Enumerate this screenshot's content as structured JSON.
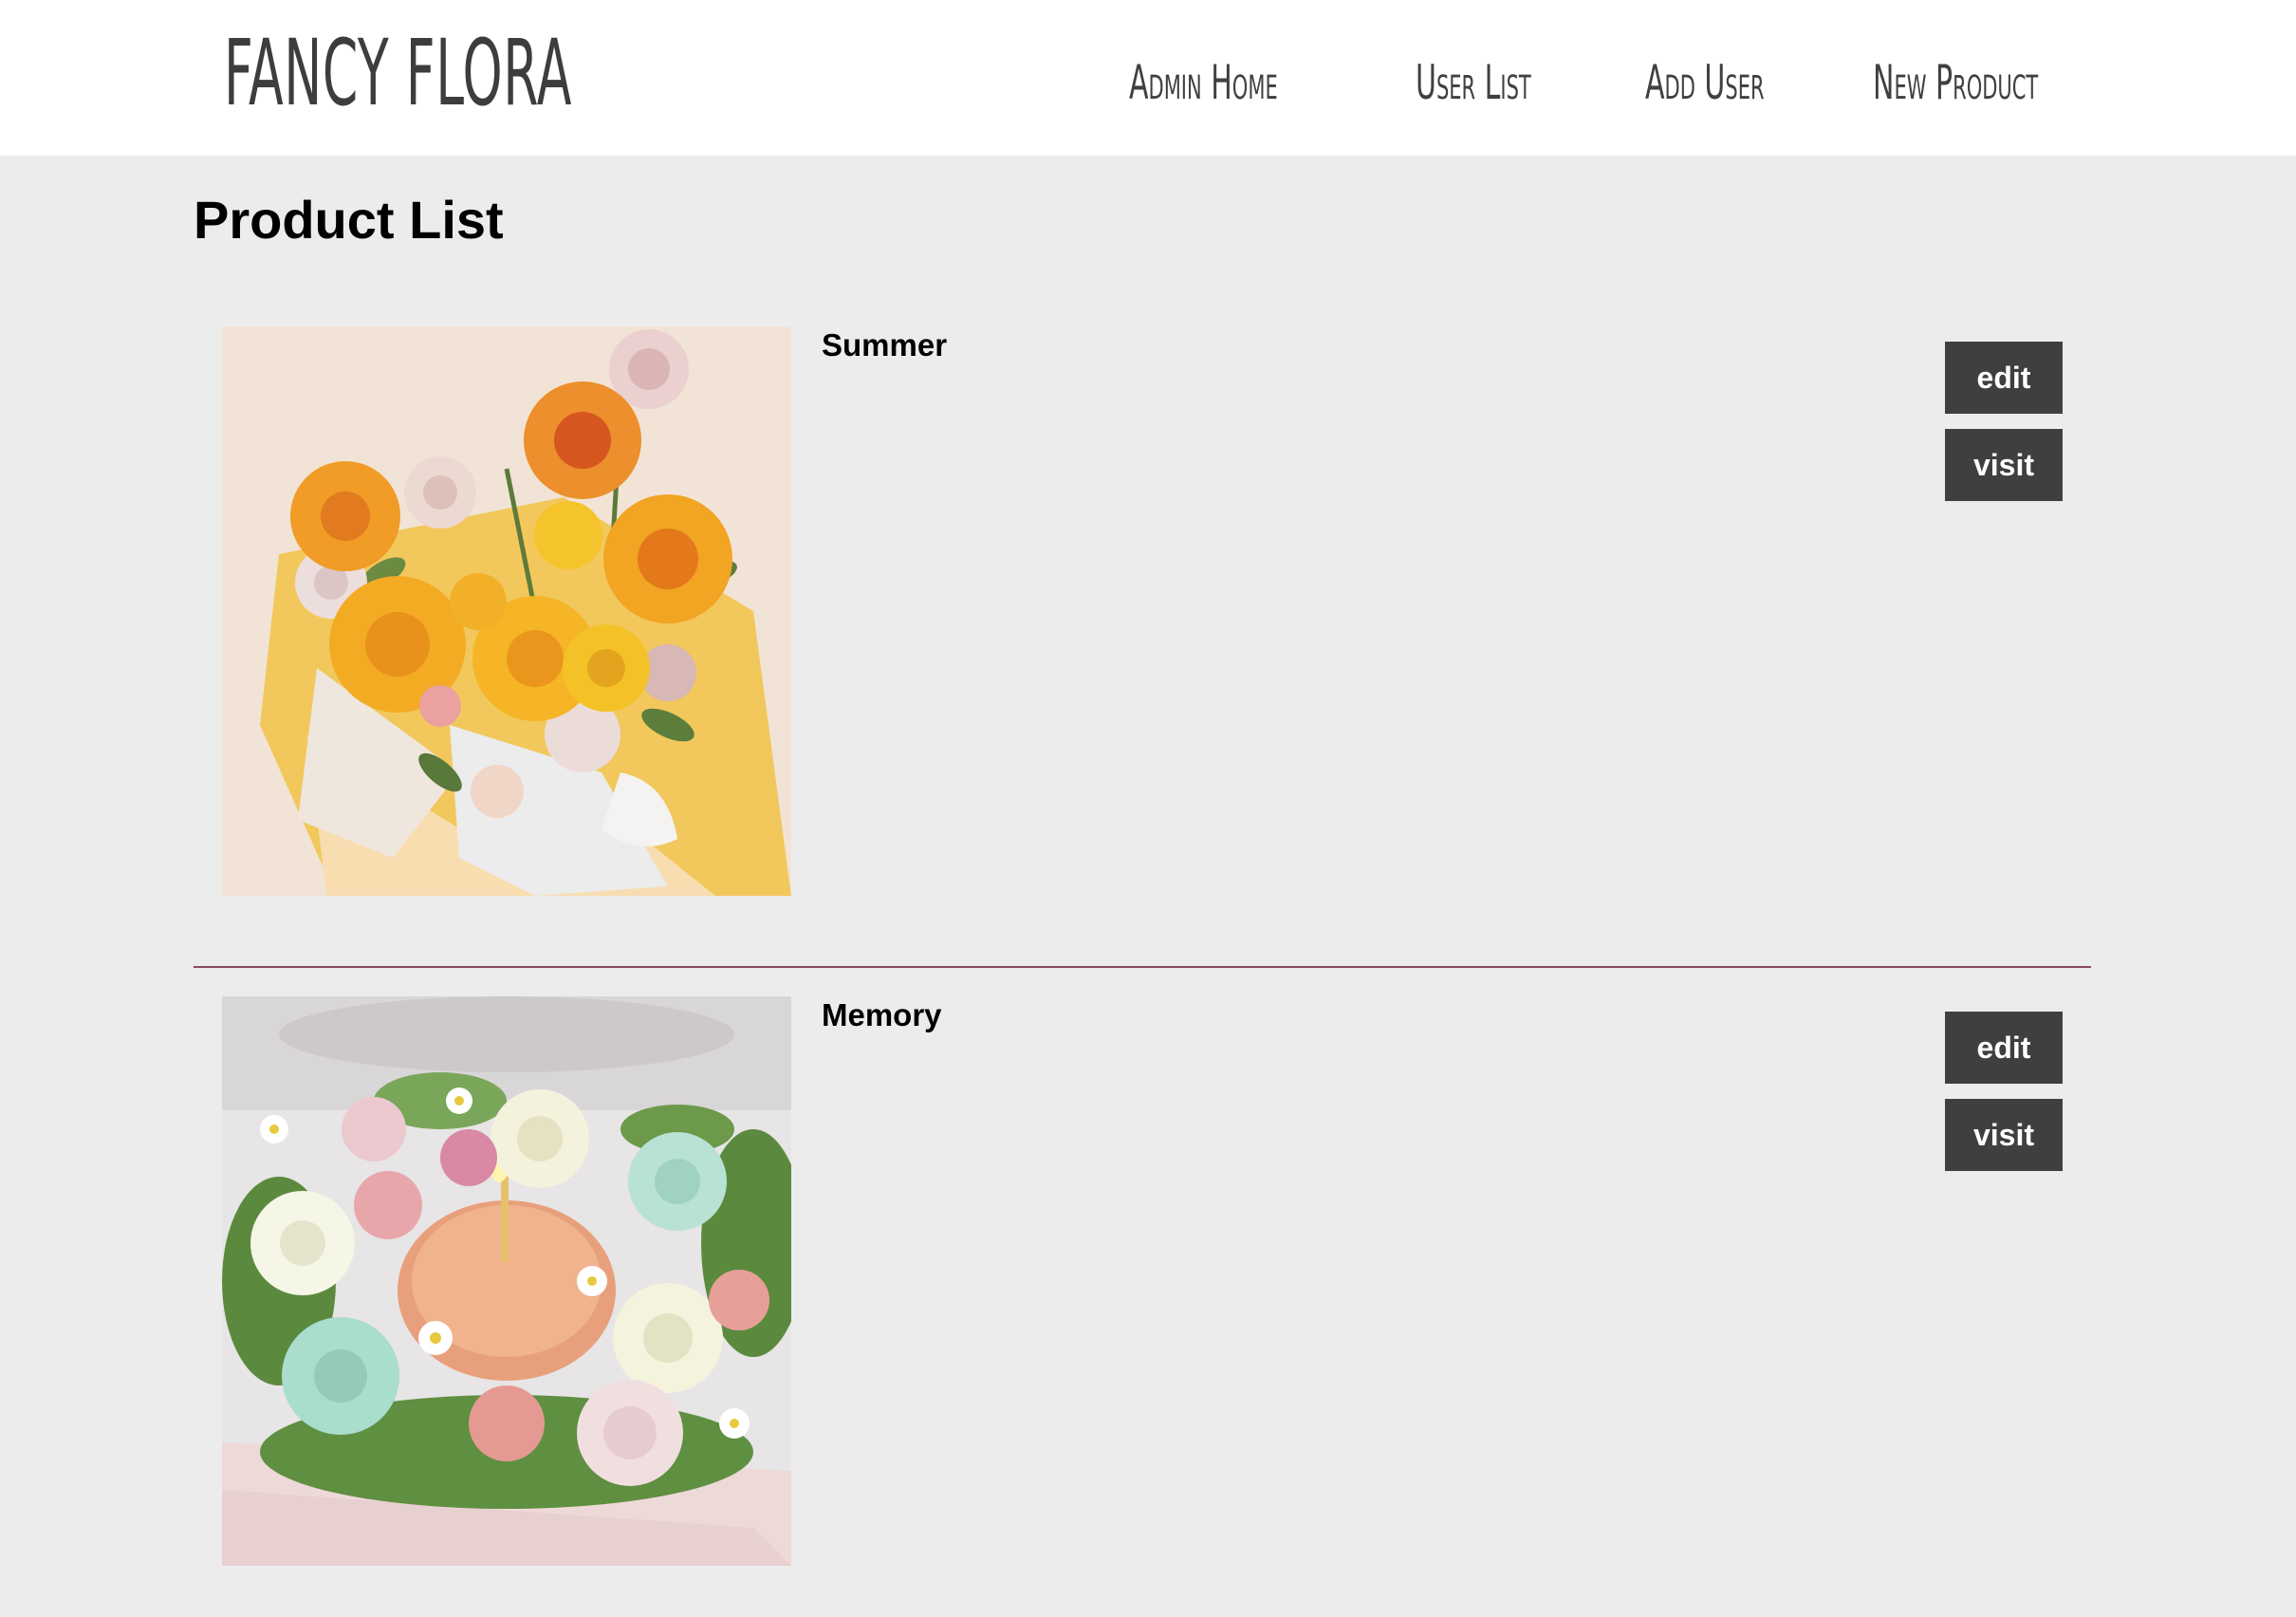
{
  "brand": {
    "name": "FANCY FLORA"
  },
  "nav": {
    "items": [
      {
        "label": "Admin Home"
      },
      {
        "label": "User List"
      },
      {
        "label": "Add User"
      },
      {
        "label": "New Product"
      }
    ]
  },
  "page": {
    "title": "Product List"
  },
  "products": [
    {
      "name": "Summer",
      "edit_label": "edit",
      "visit_label": "visit"
    },
    {
      "name": "Memory",
      "edit_label": "edit",
      "visit_label": "visit"
    }
  ],
  "colors": {
    "header_bg": "#ffffff",
    "page_bg": "#edeced",
    "button_bg": "#3f3f3f",
    "button_text": "#ffffff",
    "divider": "#8a4a5a"
  },
  "icons": {
    "product_1_image": "yellow-rose-bouquet-photo",
    "product_2_image": "flower-box-with-candle-photo"
  }
}
